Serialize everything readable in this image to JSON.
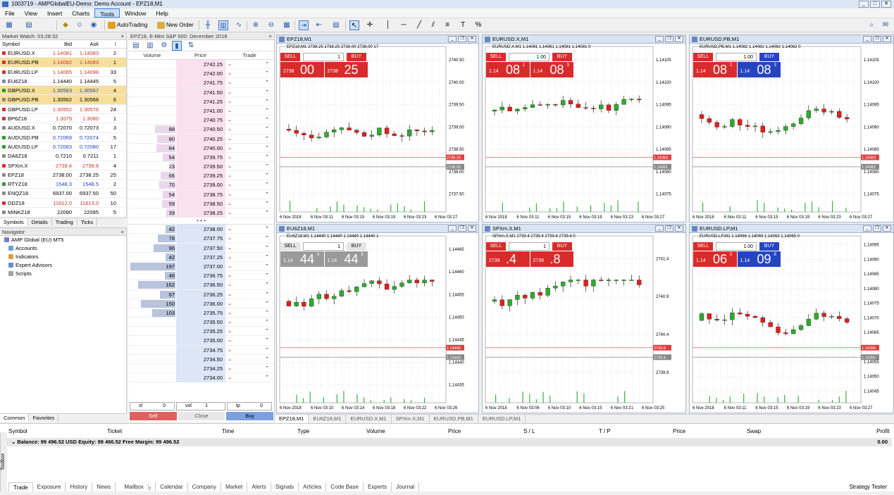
{
  "window": {
    "title": "1003719 - AMPGlobalEU-Demo: Demo Account - EPZ18,M1"
  },
  "menu": [
    "File",
    "View",
    "Insert",
    "Charts",
    "Tools",
    "Window",
    "Help"
  ],
  "toolbar": {
    "autotrading": "AutoTrading",
    "new_order": "New Order"
  },
  "market_watch": {
    "title": "Market Watch: 03:28:32",
    "cols": [
      "Symbol",
      "Bid",
      "Ask",
      "!"
    ],
    "rows": [
      {
        "sym": "EURUSD.X",
        "bid": "1.14081",
        "ask": "1.14083",
        "sp": "2",
        "hl": false,
        "c": "#d03030"
      },
      {
        "sym": "EURUSD.PB",
        "bid": "1.14082",
        "ask": "1.14083",
        "sp": "1",
        "hl": true,
        "c": "#d03030"
      },
      {
        "sym": "EURUSD.LP",
        "bid": "1.14065",
        "ask": "1.14098",
        "sp": "33",
        "hl": false,
        "c": "#d03030"
      },
      {
        "sym": "EU6Z18",
        "bid": "1.14440",
        "ask": "1.14445",
        "sp": "5",
        "hl": false,
        "c": "#888888"
      },
      {
        "sym": "GBPUSD.X",
        "bid": "1.30563",
        "ask": "1.30567",
        "sp": "4",
        "hl": true,
        "c": "#2a9a2a"
      },
      {
        "sym": "GBPUSD.PB",
        "bid": "1.30562",
        "ask": "1.30568",
        "sp": "6",
        "hl": true,
        "c": "#888888"
      },
      {
        "sym": "GBPUSD.LP",
        "bid": "1.30552",
        "ask": "1.30576",
        "sp": "24",
        "hl": false,
        "c": "#d03030"
      },
      {
        "sym": "BP6Z18",
        "bid": "1.3079",
        "ask": "1.3080",
        "sp": "1",
        "hl": false,
        "c": "#d03030"
      },
      {
        "sym": "AUDUSD.X",
        "bid": "0.72070",
        "ask": "0.72073",
        "sp": "3",
        "hl": false,
        "c": "#888888"
      },
      {
        "sym": "AUDUSD.PB",
        "bid": "0.72069",
        "ask": "0.72074",
        "sp": "5",
        "hl": false,
        "c": "#2a9a2a"
      },
      {
        "sym": "AUDUSD.LP",
        "bid": "0.72063",
        "ask": "0.72080",
        "sp": "17",
        "hl": false,
        "c": "#2a9a2a"
      },
      {
        "sym": "DA6Z18",
        "bid": "0.7210",
        "ask": "0.7211",
        "sp": "1",
        "hl": false,
        "c": "#888888"
      },
      {
        "sym": "SPXm.X",
        "bid": "2739.4",
        "ask": "2739.8",
        "sp": "4",
        "hl": false,
        "c": "#d03030"
      },
      {
        "sym": "EPZ18",
        "bid": "2738.00",
        "ask": "2738.25",
        "sp": "25",
        "hl": false,
        "c": "#888888"
      },
      {
        "sym": "RTYZ18",
        "bid": "1548.3",
        "ask": "1548.5",
        "sp": "2",
        "hl": false,
        "c": "#2a9a2a"
      },
      {
        "sym": "ENQZ18",
        "bid": "6937.00",
        "ask": "6937.50",
        "sp": "50",
        "hl": false,
        "c": "#888888"
      },
      {
        "sym": "DDZ18",
        "bid": "11612.0",
        "ask": "11613.0",
        "sp": "10",
        "hl": false,
        "c": "#d03030"
      },
      {
        "sym": "MINKZ18",
        "bid": "22090",
        "ask": "22095",
        "sp": "5",
        "hl": false,
        "c": "#888888"
      }
    ],
    "tabs": [
      "Symbols",
      "Details",
      "Trading",
      "Ticks"
    ]
  },
  "navigator": {
    "title": "Navigator",
    "items": [
      "AMP Global (EU) MT5",
      "Accounts",
      "Indicators",
      "Expert Advisors",
      "Scripts"
    ],
    "tabs": [
      "Common",
      "Favorites"
    ]
  },
  "dom": {
    "title": "EPZ18, E-Mini S&P 500: December 2018",
    "cols": [
      "Volume",
      "Price",
      "Trade"
    ],
    "asks": [
      {
        "p": "2742.25",
        "v": ""
      },
      {
        "p": "2742.00",
        "v": ""
      },
      {
        "p": "2741.75",
        "v": ""
      },
      {
        "p": "2741.50",
        "v": ""
      },
      {
        "p": "2741.25",
        "v": ""
      },
      {
        "p": "2741.00",
        "v": ""
      },
      {
        "p": "2740.75",
        "v": ""
      },
      {
        "p": "2740.50",
        "v": "88"
      },
      {
        "p": "2740.25",
        "v": "80"
      },
      {
        "p": "2740.00",
        "v": "84"
      },
      {
        "p": "2739.75",
        "v": "54"
      },
      {
        "p": "2739.50",
        "v": "23"
      },
      {
        "p": "2739.25",
        "v": "66"
      },
      {
        "p": "2739.00",
        "v": "70"
      },
      {
        "p": "2738.75",
        "v": "54"
      },
      {
        "p": "2738.50",
        "v": "59"
      },
      {
        "p": "2738.25",
        "v": "39"
      }
    ],
    "bids": [
      {
        "p": "2738.00",
        "v": "42"
      },
      {
        "p": "2737.75",
        "v": "78"
      },
      {
        "p": "2737.50",
        "v": "96"
      },
      {
        "p": "2737.25",
        "v": "42"
      },
      {
        "p": "2737.00",
        "v": "197"
      },
      {
        "p": "2736.75",
        "v": "46"
      },
      {
        "p": "2736.50",
        "v": "162"
      },
      {
        "p": "2736.25",
        "v": "67"
      },
      {
        "p": "2736.00",
        "v": "150"
      },
      {
        "p": "2735.75",
        "v": "103"
      },
      {
        "p": "2735.50",
        "v": ""
      },
      {
        "p": "2735.25",
        "v": ""
      },
      {
        "p": "2735.00",
        "v": ""
      },
      {
        "p": "2734.75",
        "v": ""
      },
      {
        "p": "2734.50",
        "v": ""
      },
      {
        "p": "2734.25",
        "v": ""
      },
      {
        "p": "2734.00",
        "v": ""
      }
    ],
    "sl": "sl",
    "sl_val": "0",
    "vol": "vol",
    "vol_val": "1",
    "tp": "tp",
    "tp_val": "0",
    "sell": "Sell",
    "close": "Close",
    "buy": "Buy"
  },
  "charts": [
    {
      "title": "EPZ18,M1",
      "info": "EPZ18,M1  2738.25 2738.25 2738.00 2738.00  17",
      "qty": "1",
      "sell_pre": "2738",
      "sell_big": "00",
      "sell_sup": "",
      "buy_pre": "2738",
      "buy_big": "25",
      "buy_sup": "",
      "buy_blue": false,
      "gray": false,
      "yticks": [
        "2740.50",
        "2740.00",
        "2739.50",
        "2739.00",
        "2738.50",
        "2738.00",
        "2737.50"
      ],
      "xticks": [
        "6 Nov 2018",
        "6 Nov 03:11",
        "6 Nov 03:15",
        "6 Nov 03:19",
        "6 Nov 03:23",
        "6 Nov 03:27"
      ],
      "redtag": "2738.25",
      "graytag": "2738.00"
    },
    {
      "title": "EURUSD.X,M1",
      "info": "EURUSD.X,M1  1.14081 1.14081 1.14081 1.14081  0",
      "qty": "1.00",
      "sell_pre": "1.14",
      "sell_big": "08",
      "sell_sup": "1",
      "buy_pre": "1.14",
      "buy_big": "08",
      "buy_sup": "3",
      "buy_blue": false,
      "gray": false,
      "yticks": [
        "1.14105",
        "1.14100",
        "1.14095",
        "1.14090",
        "1.14085",
        "1.14080",
        "1.14075"
      ],
      "xticks": [
        "6 Nov 2018",
        "6 Nov 03:11",
        "6 Nov 03:15",
        "6 Nov 03:19",
        "6 Nov 03:23",
        "6 Nov 03:27"
      ],
      "redtag": "1.14083",
      "graytag": "1.14081"
    },
    {
      "title": "EURUSD.PB,M1",
      "info": "EURUSD.PB,M1  1.14082 1.14082 1.14082 1.14082  0",
      "qty": "1.00",
      "sell_pre": "1.14",
      "sell_big": "08",
      "sell_sup": "2",
      "buy_pre": "1.14",
      "buy_big": "08",
      "buy_sup": "3",
      "buy_blue": true,
      "gray": false,
      "yticks": [
        "1.14105",
        "1.14100",
        "1.14095",
        "1.14090",
        "1.14085",
        "1.14080",
        "1.14075"
      ],
      "xticks": [
        "6 Nov 2018",
        "6 Nov 03:11",
        "6 Nov 03:15",
        "6 Nov 03:19",
        "6 Nov 03:23",
        "6 Nov 03:27"
      ],
      "redtag": "1.14083",
      "graytag": "1.14082"
    },
    {
      "title": "EU6Z18,M1",
      "info": "EU6Z18,M1  1.14440 1.14440 1.14440 1.14440  1",
      "qty": "1",
      "sell_pre": "1.14",
      "sell_big": "44",
      "sell_sup": "0",
      "buy_pre": "1.14",
      "buy_big": "44",
      "buy_sup": "5",
      "buy_blue": false,
      "gray": true,
      "yticks": [
        "1.14465",
        "1.14460",
        "1.14455",
        "1.14450",
        "1.14445",
        "1.14440",
        "1.14435"
      ],
      "xticks": [
        "6 Nov 2018",
        "6 Nov 03:10",
        "6 Nov 03:14",
        "6 Nov 03:18",
        "6 Nov 03:22",
        "6 Nov 03:26"
      ],
      "redtag": "1.14445",
      "graytag": "1.14440"
    },
    {
      "title": "SPXm.X,M1",
      "info": "SPXm.X,M1  2739.4 2739.4 2739.4 2739.4  0",
      "qty": "1",
      "sell_pre": "2739",
      "sell_big": ".4",
      "sell_sup": "",
      "buy_pre": "2739",
      "buy_big": ".8",
      "buy_sup": "",
      "buy_blue": false,
      "gray": false,
      "yticks": [
        "2741.4",
        "2740.9",
        "2740.4",
        "2739.9"
      ],
      "xticks": [
        "6 Nov 2018",
        "6 Nov 03:06",
        "6 Nov 03:10",
        "6 Nov 03:15",
        "6 Nov 03:21",
        "6 Nov 03:25"
      ],
      "redtag": "2739.8",
      "graytag": "2739.4"
    },
    {
      "title": "EURUSD.LP,M1",
      "info": "EURUSD.LP,M1  1.14066 1.14069 1.14063 1.14065  0",
      "qty": "1.00",
      "sell_pre": "1.14",
      "sell_big": "06",
      "sell_sup": "5",
      "buy_pre": "1.14",
      "buy_big": "09",
      "buy_sup": "8",
      "buy_blue": true,
      "gray": false,
      "yticks": [
        "1.14095",
        "1.14090",
        "1.14085",
        "1.14080",
        "1.14075",
        "1.14070",
        "1.14065",
        "1.14060",
        "1.14055",
        "1.14050",
        "1.14045"
      ],
      "xticks": [
        "6 Nov 2018",
        "6 Nov 03:11",
        "6 Nov 03:15",
        "6 Nov 03:19",
        "6 Nov 03:23",
        "6 Nov 03:27"
      ],
      "redtag": "1.14098",
      "graytag": "1.14065"
    }
  ],
  "chart_buttons": {
    "sell": "SELL",
    "buy": "BUY"
  },
  "chart_tabs": [
    "EPZ18,M1",
    "EU6Z18,M1",
    "EURUSD.X,M1",
    "SPXm.X,M1",
    "EURUSD.PB,M1",
    "EURUSD.LP,M1"
  ],
  "terminal": {
    "cols": [
      "Symbol",
      "Ticket",
      "Time",
      "Type",
      "Volume",
      "Price",
      "S / L",
      "T / P",
      "Price",
      "Swap",
      "Profit"
    ],
    "balance": "Balance: 99 496.52 USD  Equity: 99 496.52  Free Margin: 99 496.52",
    "profit": "0.00",
    "tabs": [
      "Trade",
      "Exposure",
      "History",
      "News",
      "Mailbox",
      "Calendar",
      "Company",
      "Market",
      "Alerts",
      "Signals",
      "Articles",
      "Code Base",
      "Experts",
      "Journal"
    ],
    "mailbox_badge": "7",
    "strategy": "Strategy Tester",
    "toolbox": "Toolbox"
  }
}
